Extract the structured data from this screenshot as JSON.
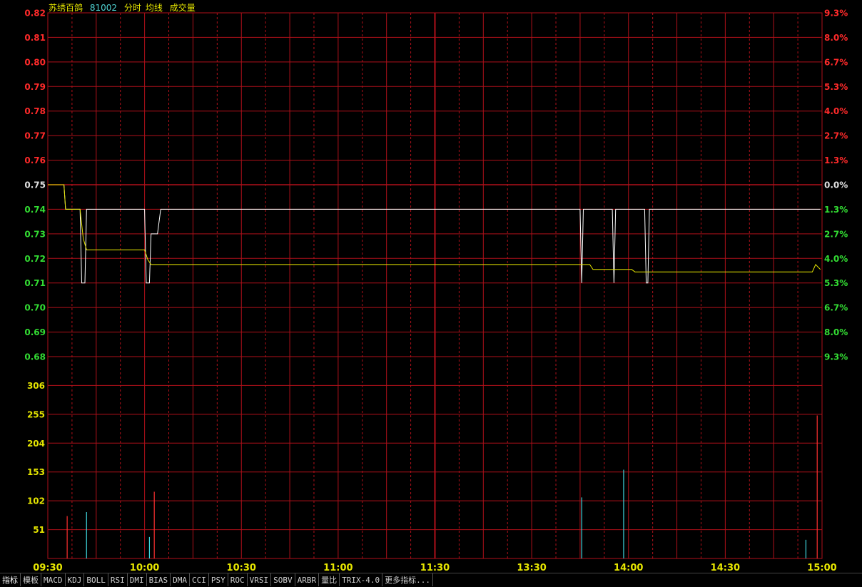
{
  "header": {
    "name": "苏绣百鸽",
    "code": "81002",
    "mode": "分时",
    "avg_label": "均线",
    "vol_label": "成交量"
  },
  "colors": {
    "grid": "#b0101a",
    "up": "#ff2a2a",
    "down": "#33dd33",
    "base": "#e0e0e0",
    "price_line": "#ffffff",
    "avg_line": "#e6e600",
    "vol_up": "#ff3030",
    "vol_down": "#40d8e0",
    "axis_text_yellow": "#e6e600"
  },
  "chart_data": {
    "type": "line",
    "title": "",
    "x_ticks": [
      "09:30",
      "10:00",
      "10:30",
      "11:00",
      "11:30",
      "13:30",
      "14:00",
      "14:30",
      "15:00"
    ],
    "price_axis": {
      "ticks": [
        "0.82",
        "0.81",
        "0.80",
        "0.79",
        "0.78",
        "0.77",
        "0.76",
        "0.75",
        "0.74",
        "0.73",
        "0.72",
        "0.71",
        "0.70",
        "0.69",
        "0.68"
      ],
      "ylim": [
        0.68,
        0.82
      ],
      "base": 0.75
    },
    "pct_axis": {
      "ticks": [
        "9.3%",
        "8.0%",
        "6.7%",
        "5.3%",
        "4.0%",
        "2.7%",
        "1.3%",
        "0.0%",
        "1.3%",
        "2.7%",
        "4.0%",
        "5.3%",
        "6.7%",
        "8.0%",
        "9.3%"
      ]
    },
    "volume_axis": {
      "ticks": [
        "306",
        "255",
        "204",
        "153",
        "102",
        "51"
      ],
      "ylim": [
        0,
        357
      ]
    },
    "series": [
      {
        "name": "分时",
        "points": [
          [
            0,
            0.75
          ],
          [
            10,
            0.75
          ],
          [
            11,
            0.74
          ],
          [
            20,
            0.74
          ],
          [
            21,
            0.71
          ],
          [
            23,
            0.71
          ],
          [
            24,
            0.74
          ],
          [
            60,
            0.74
          ],
          [
            61,
            0.71
          ],
          [
            63,
            0.71
          ],
          [
            64,
            0.73
          ],
          [
            68,
            0.73
          ],
          [
            70,
            0.74
          ],
          [
            330,
            0.74
          ],
          [
            331,
            0.71
          ],
          [
            332,
            0.74
          ],
          [
            350,
            0.74
          ],
          [
            351,
            0.71
          ],
          [
            352,
            0.74
          ],
          [
            370,
            0.74
          ],
          [
            371,
            0.71
          ],
          [
            372,
            0.71
          ],
          [
            373,
            0.74
          ],
          [
            374,
            0.74
          ],
          [
            375,
            0.74
          ],
          [
            377,
            0.74
          ],
          [
            378,
            0.74
          ],
          [
            379,
            0.74
          ],
          [
            380,
            0.74
          ],
          [
            381,
            0.74
          ],
          [
            382,
            0.74
          ],
          [
            383,
            0.74
          ],
          [
            384,
            0.74
          ],
          [
            385,
            0.74
          ],
          [
            386,
            0.74
          ],
          [
            387,
            0.74
          ],
          [
            388,
            0.74
          ],
          [
            389,
            0.74
          ],
          [
            390,
            0.74
          ],
          [
            391,
            0.74
          ],
          [
            392,
            0.74
          ],
          [
            393,
            0.74
          ],
          [
            394,
            0.74
          ],
          [
            395,
            0.74
          ],
          [
            396,
            0.74
          ],
          [
            397,
            0.74
          ],
          [
            398,
            0.74
          ],
          [
            399,
            0.74
          ],
          [
            400,
            0.74
          ],
          [
            401,
            0.74
          ],
          [
            402,
            0.74
          ],
          [
            403,
            0.74
          ],
          [
            404,
            0.74
          ],
          [
            405,
            0.74
          ],
          [
            406,
            0.74
          ],
          [
            407,
            0.74
          ],
          [
            408,
            0.74
          ],
          [
            409,
            0.74
          ],
          [
            410,
            0.74
          ],
          [
            411,
            0.74
          ],
          [
            412,
            0.74
          ],
          [
            413,
            0.74
          ],
          [
            414,
            0.74
          ],
          [
            415,
            0.74
          ],
          [
            416,
            0.74
          ],
          [
            417,
            0.74
          ],
          [
            418,
            0.74
          ],
          [
            419,
            0.74
          ],
          [
            420,
            0.74
          ],
          [
            421,
            0.74
          ],
          [
            422,
            0.74
          ],
          [
            423,
            0.74
          ],
          [
            424,
            0.74
          ],
          [
            425,
            0.74
          ],
          [
            426,
            0.74
          ],
          [
            427,
            0.74
          ],
          [
            428,
            0.74
          ],
          [
            429,
            0.74
          ],
          [
            430,
            0.74
          ],
          [
            431,
            0.74
          ],
          [
            432,
            0.74
          ],
          [
            433,
            0.74
          ],
          [
            434,
            0.74
          ],
          [
            435,
            0.74
          ],
          [
            436,
            0.74
          ],
          [
            437,
            0.74
          ],
          [
            438,
            0.74
          ],
          [
            439,
            0.74
          ],
          [
            440,
            0.74
          ],
          [
            441,
            0.74
          ],
          [
            442,
            0.74
          ],
          [
            443,
            0.74
          ],
          [
            444,
            0.74
          ],
          [
            445,
            0.74
          ],
          [
            446,
            0.74
          ],
          [
            447,
            0.74
          ],
          [
            448,
            0.74
          ],
          [
            449,
            0.74
          ],
          [
            450,
            0.74
          ],
          [
            451,
            0.74
          ],
          [
            452,
            0.74
          ],
          [
            453,
            0.74
          ],
          [
            454,
            0.74
          ],
          [
            455,
            0.74
          ],
          [
            456,
            0.74
          ],
          [
            457,
            0.74
          ],
          [
            458,
            0.74
          ],
          [
            459,
            0.74
          ],
          [
            460,
            0.74
          ],
          [
            461,
            0.74
          ],
          [
            462,
            0.74
          ],
          [
            463,
            0.74
          ],
          [
            464,
            0.74
          ],
          [
            465,
            0.74
          ],
          [
            466,
            0.74
          ],
          [
            467,
            0.74
          ],
          [
            468,
            0.74
          ],
          [
            469,
            0.74
          ],
          [
            470,
            0.74
          ],
          [
            471,
            0.74
          ],
          [
            472,
            0.74
          ],
          [
            473,
            0.74
          ],
          [
            474,
            0.74
          ],
          [
            475,
            0.74
          ],
          [
            476,
            0.74
          ],
          [
            477,
            0.74
          ],
          [
            478,
            0.74
          ],
          [
            479,
            0.74
          ]
        ]
      },
      {
        "name": "均线",
        "points": [
          [
            0,
            0.75
          ],
          [
            10,
            0.75
          ],
          [
            11,
            0.74
          ],
          [
            20,
            0.74
          ],
          [
            22,
            0.728
          ],
          [
            24,
            0.7235
          ],
          [
            60,
            0.7235
          ],
          [
            62,
            0.7195
          ],
          [
            64,
            0.7175
          ],
          [
            336,
            0.7175
          ],
          [
            338,
            0.7155
          ],
          [
            362,
            0.7155
          ],
          [
            364,
            0.7145
          ],
          [
            474,
            0.7145
          ],
          [
            476,
            0.7175
          ],
          [
            479,
            0.7155
          ]
        ]
      }
    ],
    "volume": [
      {
        "t": 12,
        "v": 75,
        "dir": "up"
      },
      {
        "t": 24,
        "v": 82,
        "dir": "down"
      },
      {
        "t": 63,
        "v": 38,
        "dir": "down"
      },
      {
        "t": 66,
        "v": 118,
        "dir": "up"
      },
      {
        "t": 331,
        "v": 108,
        "dir": "down"
      },
      {
        "t": 357,
        "v": 157,
        "dir": "down"
      },
      {
        "t": 470,
        "v": 33,
        "dir": "down"
      },
      {
        "t": 477,
        "v": 253,
        "dir": "up"
      }
    ]
  },
  "tabs": [
    "指标",
    "模板",
    "MACD",
    "KDJ",
    "BOLL",
    "RSI",
    "DMI",
    "BIAS",
    "DMA",
    "CCI",
    "PSY",
    "ROC",
    "VRSI",
    "SOBV",
    "ARBR",
    "量比",
    "TRIX-4.0",
    "更多指标..."
  ]
}
